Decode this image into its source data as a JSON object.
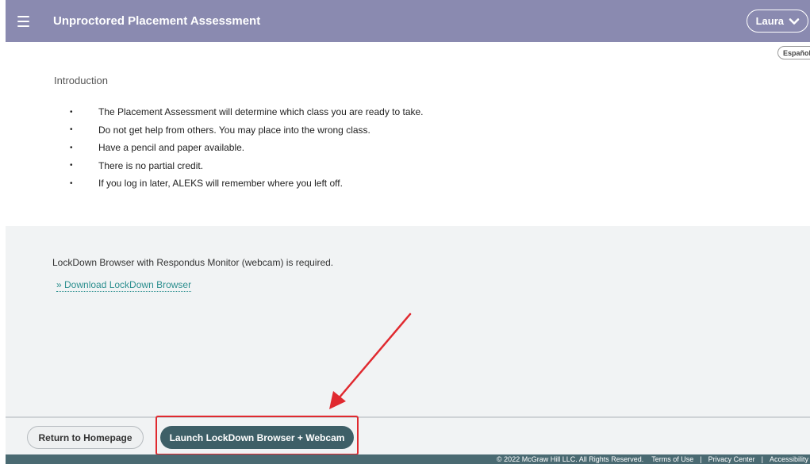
{
  "header": {
    "title": "Unproctored Placement Assessment",
    "user_name": "Laura",
    "menu_icon": "hamburger-icon",
    "chevron_icon": "chevron-down-icon"
  },
  "language_button": "Español",
  "intro": {
    "title": "Introduction",
    "bullets": [
      "The Placement Assessment will determine which class you are ready to take.",
      "Do not get help from others. You may place into the wrong class.",
      "Have a pencil and paper available.",
      "There is no partial credit.",
      "If you log in later, ALEKS will remember where you left off."
    ],
    "bullet_glyph": "•"
  },
  "lockdown": {
    "requirement_text": "LockDown Browser with Respondus Monitor (webcam) is required.",
    "download_link": "» Download LockDown Browser"
  },
  "actions": {
    "return_label": "Return to Homepage",
    "launch_label": "Launch LockDown Browser + Webcam"
  },
  "footer": {
    "copyright": "© 2022 McGraw Hill LLC. All Rights Reserved.",
    "links": [
      "Terms of Use",
      "Privacy Center",
      "Accessibility"
    ],
    "separator": "|"
  },
  "colors": {
    "header_bg": "#8a8ab0",
    "launch_button": "#3e5f67",
    "link": "#2d8f8f",
    "annotation": "#e0292f"
  }
}
